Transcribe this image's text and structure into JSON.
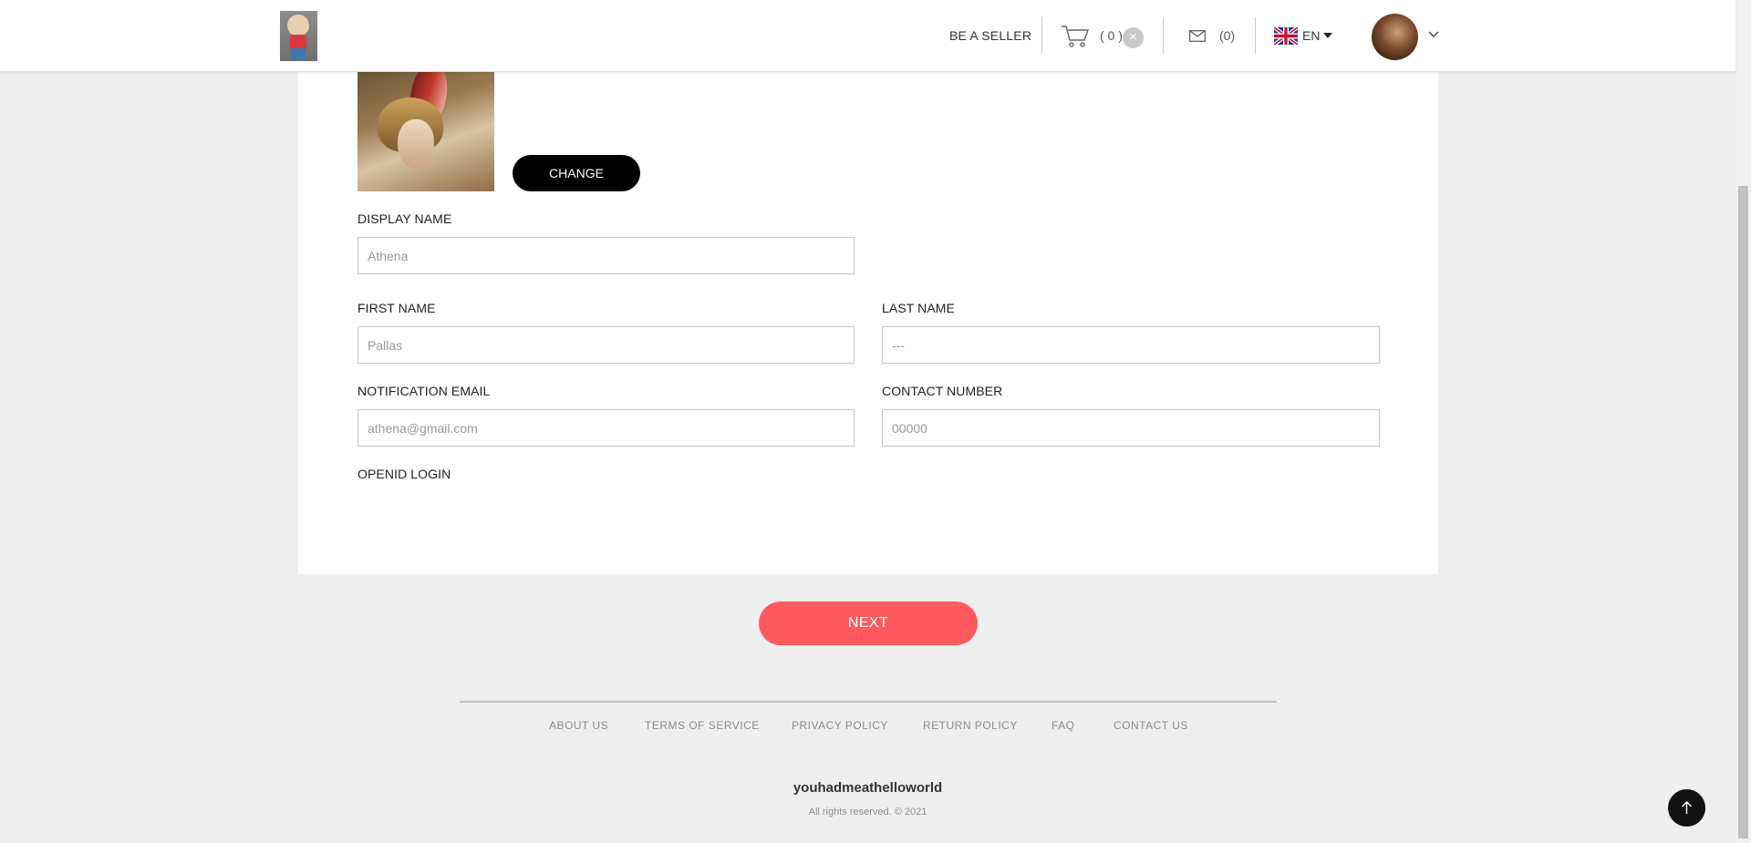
{
  "header": {
    "be_seller": "BE A SELLER",
    "cart_count": "( 0 )",
    "cart_clear": "×",
    "messages_count": "(0)",
    "language": "EN"
  },
  "profile": {
    "change_button": "CHANGE",
    "display_name_label": "DISPLAY NAME",
    "display_name_placeholder": "Athena",
    "first_name_label": "FIRST NAME",
    "first_name_placeholder": "Pallas",
    "last_name_label": "LAST NAME",
    "last_name_placeholder": "---",
    "email_label": "NOTIFICATION EMAIL",
    "email_placeholder": "athena@gmail.com",
    "contact_label": "CONTACT NUMBER",
    "contact_placeholder": "00000",
    "openid_label": "OPENID LOGIN"
  },
  "next_button": "NEXT",
  "footer": {
    "links": [
      "ABOUT US",
      "TERMS OF SERVICE",
      "PRIVACY POLICY",
      "RETURN POLICY",
      "FAQ",
      "CONTACT US"
    ],
    "brand": "youhadmeathelloworld",
    "copyright": "All rights reserved. © 2021"
  },
  "colors": {
    "accent": "#ff5a5f",
    "background": "#efefef",
    "primary_button": "#000000"
  },
  "icons": [
    "logo-image",
    "cart-icon",
    "close-icon",
    "mail-icon",
    "uk-flag-icon",
    "caret-down-icon",
    "user-avatar",
    "chevron-down-icon",
    "arrow-up-icon"
  ]
}
